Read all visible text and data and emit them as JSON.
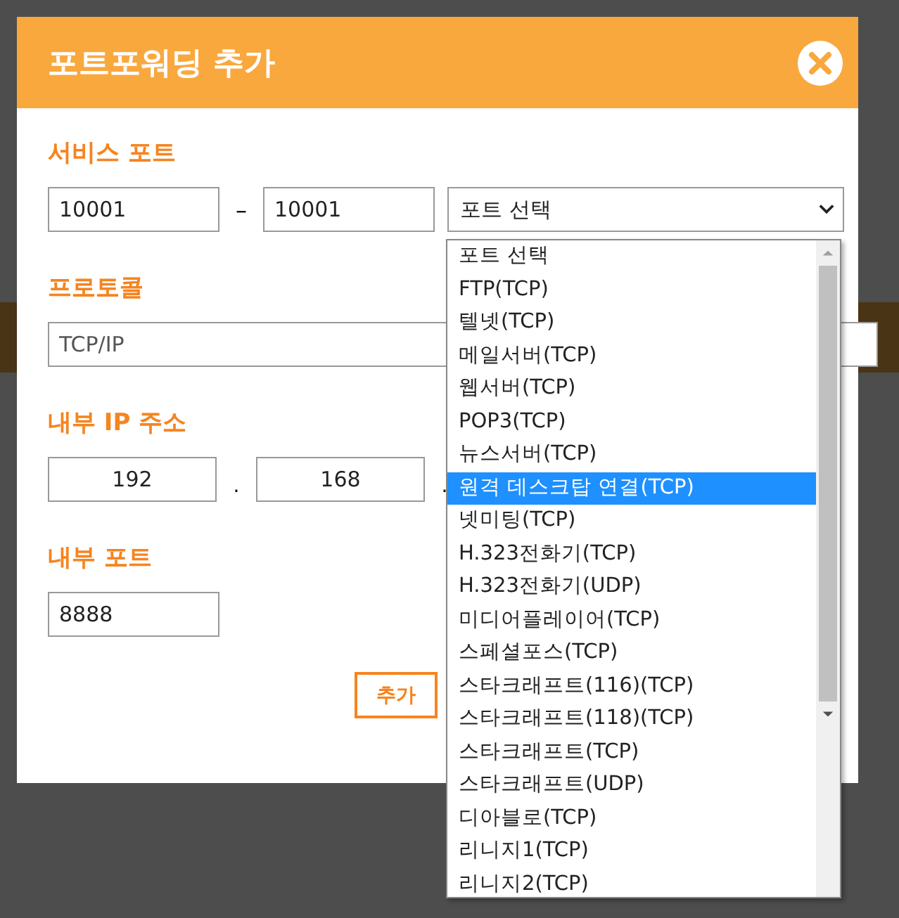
{
  "dialog": {
    "title": "포트포워딩 추가",
    "service_port": {
      "label": "서비스 포트",
      "from": "10001",
      "separator": "–",
      "to": "10001",
      "select": {
        "value": "포트 선택",
        "options": [
          {
            "label": "포트 선택",
            "highlighted": false
          },
          {
            "label": "FTP(TCP)",
            "highlighted": false
          },
          {
            "label": "텔넷(TCP)",
            "highlighted": false
          },
          {
            "label": "메일서버(TCP)",
            "highlighted": false
          },
          {
            "label": "웹서버(TCP)",
            "highlighted": false
          },
          {
            "label": "POP3(TCP)",
            "highlighted": false
          },
          {
            "label": "뉴스서버(TCP)",
            "highlighted": false
          },
          {
            "label": "원격 데스크탑 연결(TCP)",
            "highlighted": true
          },
          {
            "label": "넷미팅(TCP)",
            "highlighted": false
          },
          {
            "label": "H.323전화기(TCP)",
            "highlighted": false
          },
          {
            "label": "H.323전화기(UDP)",
            "highlighted": false
          },
          {
            "label": "미디어플레이어(TCP)",
            "highlighted": false
          },
          {
            "label": "스페셜포스(TCP)",
            "highlighted": false
          },
          {
            "label": "스타크래프트(116)(TCP)",
            "highlighted": false
          },
          {
            "label": "스타크래프트(118)(TCP)",
            "highlighted": false
          },
          {
            "label": "스타크래프트(TCP)",
            "highlighted": false
          },
          {
            "label": "스타크래프트(UDP)",
            "highlighted": false
          },
          {
            "label": "디아블로(TCP)",
            "highlighted": false
          },
          {
            "label": "리니지1(TCP)",
            "highlighted": false
          },
          {
            "label": "리니지2(TCP)",
            "highlighted": false
          }
        ]
      }
    },
    "protocol": {
      "label": "프로토콜",
      "value": "TCP/IP"
    },
    "internal_ip": {
      "label": "내부 IP 주소",
      "octets": [
        "192",
        "168"
      ],
      "separator": "."
    },
    "internal_port": {
      "label": "내부 포트",
      "value": "8888"
    },
    "add_button": "추가"
  }
}
